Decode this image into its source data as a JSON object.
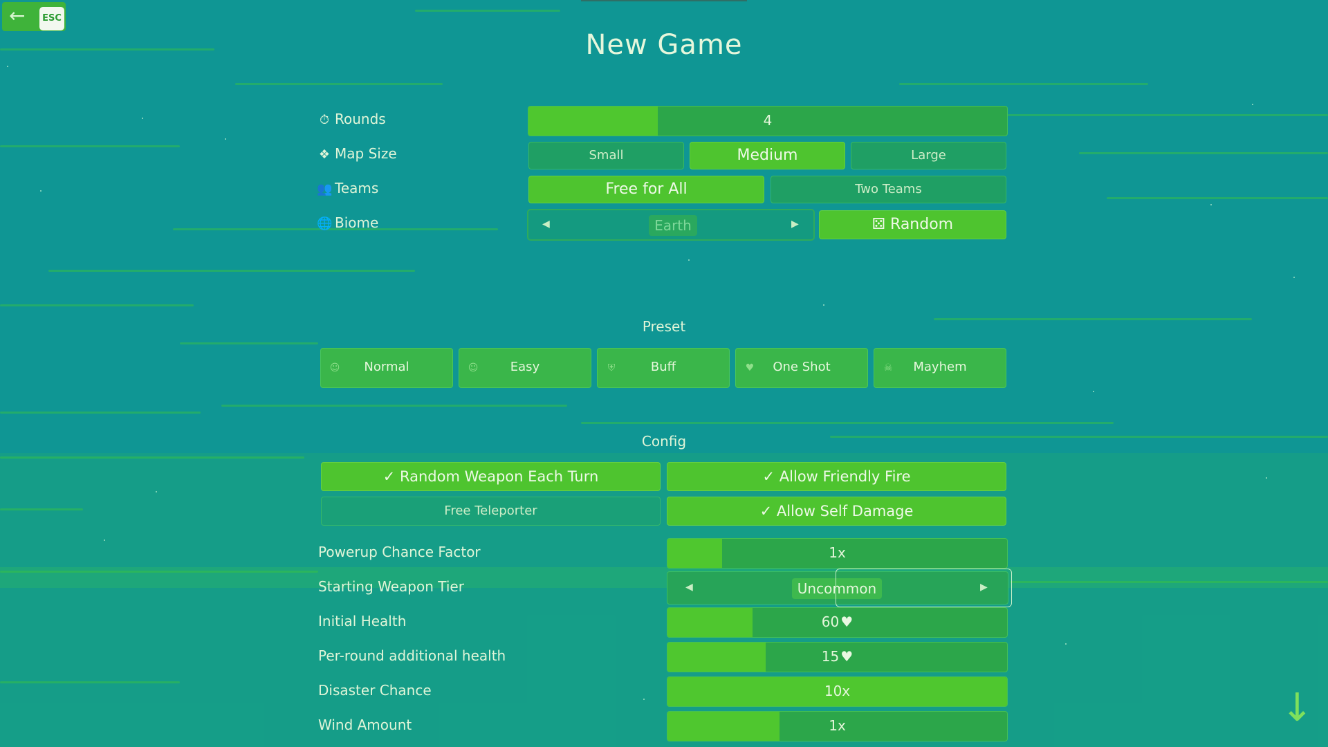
{
  "header": {
    "title": "New Game",
    "esc_label": "ESC",
    "back_icon": "arrow-left-icon"
  },
  "settings": {
    "rounds": {
      "label": "Rounds",
      "value": "4",
      "fill_fraction": 0.27
    },
    "map_size": {
      "label": "Map Size",
      "options": [
        "Small",
        "Medium",
        "Large"
      ],
      "selected": "Medium"
    },
    "teams": {
      "label": "Teams",
      "options": [
        "Free for All",
        "Two Teams"
      ],
      "selected": "Free for All"
    },
    "biome": {
      "label": "Biome",
      "value": "Earth",
      "random_label": "Random"
    }
  },
  "preset": {
    "heading": "Preset",
    "items": [
      {
        "label": "Normal",
        "icon": "smile-icon"
      },
      {
        "label": "Easy",
        "icon": "smile-icon"
      },
      {
        "label": "Buff",
        "icon": "shield-icon"
      },
      {
        "label": "One Shot",
        "icon": "broken-heart-icon"
      },
      {
        "label": "Mayhem",
        "icon": "skull-icon"
      }
    ]
  },
  "config": {
    "heading": "Config",
    "toggles": [
      {
        "label": "Random Weapon Each Turn",
        "on": true
      },
      {
        "label": "Allow Friendly Fire",
        "on": true
      },
      {
        "label": "Free Teleporter",
        "on": false
      },
      {
        "label": "Allow Self Damage",
        "on": true
      }
    ],
    "rows": [
      {
        "label": "Powerup Chance Factor",
        "value": "1x",
        "fill_fraction": 0.16
      },
      {
        "label": "Starting Weapon Tier",
        "value": "Uncommon"
      },
      {
        "label": "Initial Health",
        "value": "60",
        "fill_fraction": 0.25,
        "heart": true
      },
      {
        "label": "Per-round additional health",
        "value": "15",
        "fill_fraction": 0.29,
        "heart": true
      },
      {
        "label": "Disaster Chance",
        "value": "10x",
        "fill_fraction": 1.0
      },
      {
        "label": "Wind Amount",
        "value": "1x",
        "fill_fraction": 0.33
      }
    ]
  },
  "colors": {
    "background": "#0f9694",
    "accent": "#4fc72f",
    "bar": "#2ca64a"
  },
  "scroll_icon": "arrow-down-icon"
}
